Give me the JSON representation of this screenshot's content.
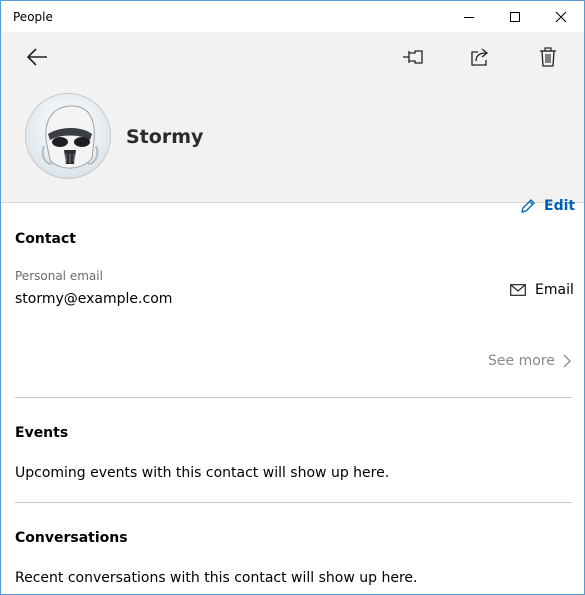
{
  "window": {
    "title": "People"
  },
  "header": {
    "contact_name": "Stormy"
  },
  "contact_section": {
    "title": "Contact",
    "edit_label": "Edit",
    "field_label": "Personal email",
    "field_value": "stormy@example.com",
    "email_action_label": "Email",
    "see_more_label": "See more"
  },
  "events_section": {
    "title": "Events",
    "empty_text": "Upcoming events with this contact will show up here."
  },
  "conversations_section": {
    "title": "Conversations",
    "empty_text": "Recent conversations with this contact will show up here."
  },
  "icons": {
    "back": "arrow-left-icon",
    "pin": "pin-icon",
    "share": "share-icon",
    "delete": "trash-icon",
    "edit": "pencil-icon",
    "email": "mail-icon",
    "see_more": "chevron-right-icon"
  },
  "colors": {
    "accent": "#0063b1",
    "header_bg": "#f2f2f2",
    "window_border": "#5b9bd5"
  }
}
